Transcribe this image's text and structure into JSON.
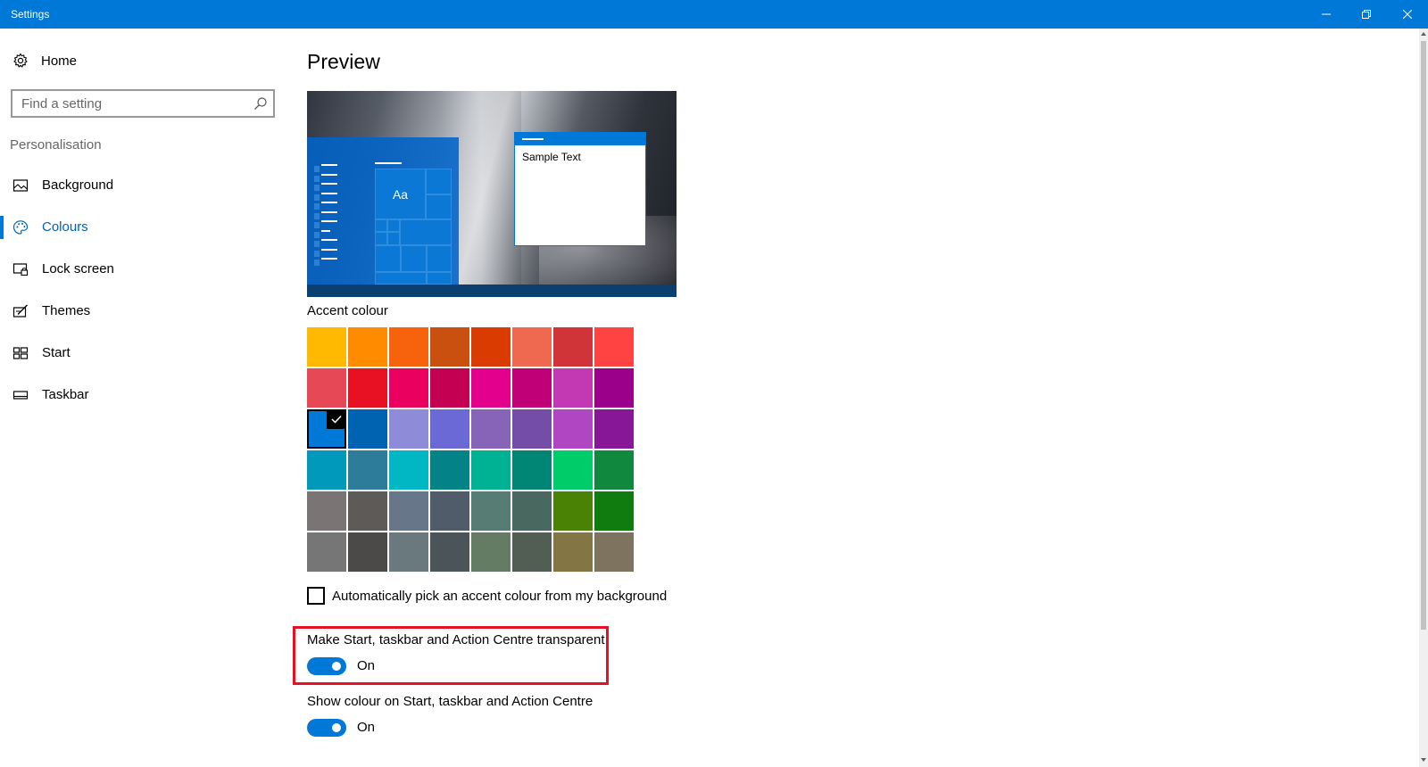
{
  "window": {
    "title": "Settings",
    "accent": "#0078d7",
    "controls": [
      "minimize-icon",
      "maximize-icon",
      "close-icon"
    ]
  },
  "sidebar": {
    "home_label": "Home",
    "home_icon": "gear-icon",
    "search": {
      "placeholder": "Find a setting",
      "value": "",
      "icon": "search-icon"
    },
    "section_label": "Personalisation",
    "items": [
      {
        "label": "Background",
        "icon": "picture-icon",
        "active": false
      },
      {
        "label": "Colours",
        "icon": "palette-icon",
        "active": true
      },
      {
        "label": "Lock screen",
        "icon": "lock-screen-icon",
        "active": false
      },
      {
        "label": "Themes",
        "icon": "themes-icon",
        "active": false
      },
      {
        "label": "Start",
        "icon": "start-icon",
        "active": false
      },
      {
        "label": "Taskbar",
        "icon": "taskbar-icon",
        "active": false
      }
    ]
  },
  "main": {
    "preview_heading": "Preview",
    "preview": {
      "sample_text": "Sample Text",
      "tile_text": "Aa"
    },
    "accent_heading": "Accent colour",
    "accent_colors": [
      [
        "#ffb900",
        "#ff8c00",
        "#f7630c",
        "#ca5010",
        "#da3b01",
        "#ef6950",
        "#d13438",
        "#ff4343"
      ],
      [
        "#e74856",
        "#e81123",
        "#ea005e",
        "#c30052",
        "#e3008c",
        "#bf0077",
        "#c239b3",
        "#9a0089"
      ],
      [
        "#0078d7",
        "#0063b1",
        "#8e8cd8",
        "#6b69d6",
        "#8764b8",
        "#744da9",
        "#b146c2",
        "#881798"
      ],
      [
        "#0099bc",
        "#2d7d9a",
        "#00b7c3",
        "#038387",
        "#00b294",
        "#018574",
        "#00cc6a",
        "#10893e"
      ],
      [
        "#7a7574",
        "#5d5a58",
        "#68768a",
        "#515c6b",
        "#567c73",
        "#486860",
        "#498205",
        "#107c10"
      ],
      [
        "#767676",
        "#4c4a48",
        "#69797e",
        "#4a5459",
        "#647c64",
        "#525e54",
        "#847545",
        "#7e735f"
      ]
    ],
    "selected_color": {
      "row": 2,
      "col": 0,
      "hex": "#0078d7"
    },
    "auto_pick": {
      "label": "Automatically pick an accent colour from my background",
      "checked": false
    },
    "transparent": {
      "label": "Make Start, taskbar and Action Centre transparent",
      "on": true,
      "state_label": "On"
    },
    "show_colour": {
      "label": "Show colour on Start, taskbar and Action Centre",
      "on": true,
      "state_label": "On"
    },
    "highlight_color": "#e81123"
  }
}
